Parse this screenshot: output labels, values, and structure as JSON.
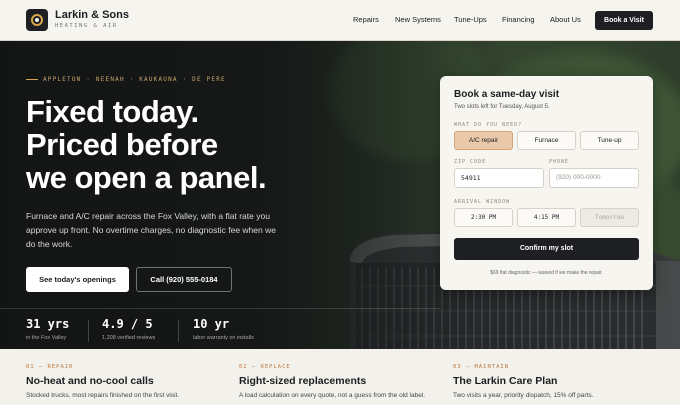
{
  "brand": {
    "name": "Larkin & Sons",
    "tagline": "HEATING & AIR"
  },
  "nav": {
    "items": [
      "Repairs",
      "New Systems",
      "Tune-Ups",
      "Financing",
      "About Us"
    ],
    "cta": "Book a Visit"
  },
  "hero": {
    "eyebrow": "APPLETON · NEENAH · KAUKAUNA · DE PERE",
    "headline": [
      "Fixed today.",
      "Priced before",
      "we open a panel."
    ],
    "lede": "Furnace and A/C repair across the Fox Valley, with a flat rate you approve up front. No overtime charges, no diagnostic fee when we do the work.",
    "primary_cta": "See today's openings",
    "secondary_cta": "Call (920) 555-0184"
  },
  "stats": [
    {
      "value": "31 yrs",
      "label": "in the Fox Valley"
    },
    {
      "value": "4.9 / 5",
      "label": "1,208 verified reviews"
    },
    {
      "value": "10 yr",
      "label": "labor warranty on installs"
    }
  ],
  "booking": {
    "title": "Book a same-day visit",
    "subtitle": "Two slots left for Tuesday, August 5.",
    "need_label": "WHAT DO YOU NEED?",
    "needs": [
      "A/C repair",
      "Furnace",
      "Tune-up"
    ],
    "selected_need": "A/C repair",
    "zip_label": "ZIP CODE",
    "zip_value": "54911",
    "phone_label": "PHONE",
    "phone_placeholder": "(920) 000-0000",
    "window_label": "ARRIVAL WINDOW",
    "windows": [
      "2:30 PM",
      "4:15 PM",
      "Tomorrow"
    ],
    "confirm": "Confirm my slot",
    "footnote": "$69 flat diagnostic — waived if we make the repair."
  },
  "services": [
    {
      "tag": "01 — REPAIR",
      "title": "No-heat and no-cool calls",
      "desc": "Stocked trucks, most repairs finished on the first visit."
    },
    {
      "tag": "02 — REPLACE",
      "title": "Right-sized replacements",
      "desc": "A load calculation on every quote, not a guess from the old label."
    },
    {
      "tag": "03 — MAINTAIN",
      "title": "The Larkin Care Plan",
      "desc": "Two visits a year, priority dispatch, 15% off parts."
    }
  ],
  "colors": {
    "accent": "#d9a54a",
    "dark": "#1d1f23",
    "selected_chip": "#e9c9a9",
    "tag": "#c0763a"
  }
}
